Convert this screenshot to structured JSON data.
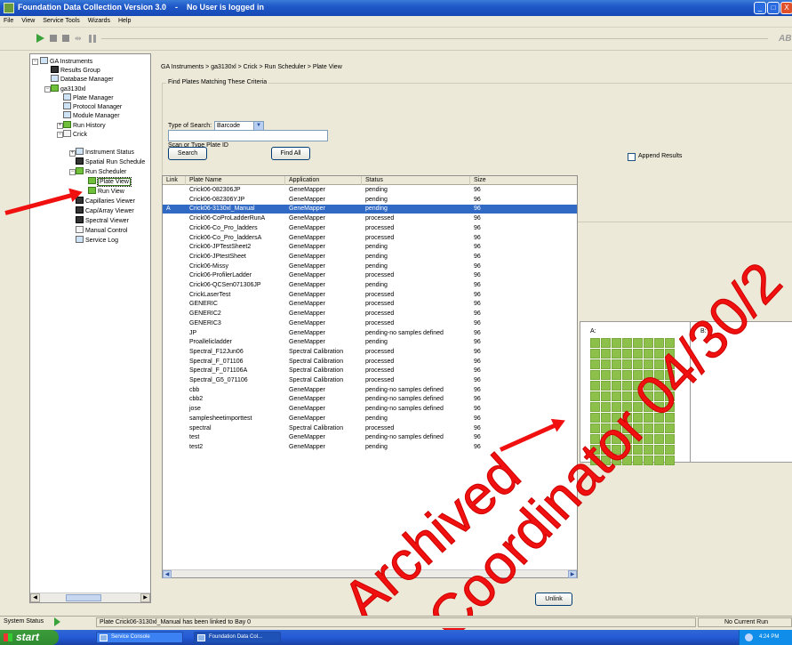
{
  "window": {
    "title": "Foundation Data Collection Version 3.0    -    No User is logged in",
    "controls": [
      "_",
      "□",
      "X"
    ]
  },
  "menu": [
    "File",
    "View",
    "Service Tools",
    "Wizards",
    "Help"
  ],
  "toolbar": {
    "brand": "AB"
  },
  "tree": {
    "nodes": [
      {
        "label": "GA Instruments",
        "icon": "instrument-icon"
      },
      {
        "label": "Results Group",
        "icon": "results-group-icon"
      },
      {
        "label": "Database Manager",
        "icon": "database-icon"
      },
      {
        "label": "ga3130xl",
        "icon": "instrument-icon"
      },
      {
        "label": "Plate Manager",
        "icon": "plate-manager-icon"
      },
      {
        "label": "Protocol Manager",
        "icon": "protocol-icon"
      },
      {
        "label": "Module Manager",
        "icon": "module-icon"
      },
      {
        "label": "Run History",
        "icon": "run-history-icon"
      },
      {
        "label": "Crick",
        "icon": "folder-icon"
      },
      {
        "label": "Instrument Status",
        "icon": "status-icon"
      },
      {
        "label": "Spatial Run Schedule",
        "icon": "spatial-icon"
      },
      {
        "label": "Run Scheduler",
        "icon": "scheduler-icon"
      },
      {
        "label": "Plate View",
        "icon": "plate-view-icon"
      },
      {
        "label": "Run View",
        "icon": "run-view-icon"
      },
      {
        "label": "Capillaries Viewer",
        "icon": "capillaries-icon"
      },
      {
        "label": "Cap/Array Viewer",
        "icon": "cap-array-icon"
      },
      {
        "label": "Spectral Viewer",
        "icon": "spectral-icon"
      },
      {
        "label": "Manual Control",
        "icon": "manual-control-icon"
      },
      {
        "label": "Service Log",
        "icon": "service-log-icon"
      }
    ]
  },
  "main": {
    "breadcrumb": "GA Instruments > ga3130xl > Crick > Run Scheduler > Plate View",
    "criteria_legend": "Find Plates Matching These Criteria",
    "type_of_search_label": "Type of Search:",
    "type_of_search_value": "Barcode",
    "scan_label": "Scan or Type Plate ID",
    "plate_id_value": "",
    "search_button": "Search",
    "find_all_button": "Find All",
    "append_results_label": "Append Results",
    "unlink_button": "Unlink"
  },
  "table": {
    "columns": [
      "Link",
      "Plate Name",
      "Application",
      "Status",
      "Size"
    ],
    "rows": [
      [
        "",
        "Crick06-082306JP",
        "GeneMapper",
        "pending",
        "96"
      ],
      [
        "",
        "Crick06-082306YJP",
        "GeneMapper",
        "pending",
        "96"
      ],
      [
        "A",
        "Crick06-3130xl_Manual",
        "GeneMapper",
        "pending",
        "96"
      ],
      [
        "",
        "Crick06-CoProLadderRunA",
        "GeneMapper",
        "processed",
        "96"
      ],
      [
        "",
        "Crick06-Co_Pro_ladders",
        "GeneMapper",
        "processed",
        "96"
      ],
      [
        "",
        "Crick06-Co_Pro_laddersA",
        "GeneMapper",
        "processed",
        "96"
      ],
      [
        "",
        "Crick06-JPTestSheet2",
        "GeneMapper",
        "pending",
        "96"
      ],
      [
        "",
        "Crick06-JPtestSheet",
        "GeneMapper",
        "pending",
        "96"
      ],
      [
        "",
        "Crick06-Missy",
        "GeneMapper",
        "pending",
        "96"
      ],
      [
        "",
        "Crick06-ProfilerLadder",
        "GeneMapper",
        "processed",
        "96"
      ],
      [
        "",
        "Crick06-QCSen071306JP",
        "GeneMapper",
        "pending",
        "96"
      ],
      [
        "",
        "CrickLaserTest",
        "GeneMapper",
        "processed",
        "96"
      ],
      [
        "",
        "GENERIC",
        "GeneMapper",
        "processed",
        "96"
      ],
      [
        "",
        "GENERIC2",
        "GeneMapper",
        "processed",
        "96"
      ],
      [
        "",
        "GENERIC3",
        "GeneMapper",
        "processed",
        "96"
      ],
      [
        "",
        "JP",
        "GeneMapper",
        "pending-no samples defined",
        "96"
      ],
      [
        "",
        "Proallelicladder",
        "GeneMapper",
        "pending",
        "96"
      ],
      [
        "",
        "Spectral_F12Jun06",
        "Spectral Calibration",
        "processed",
        "96"
      ],
      [
        "",
        "Spectral_F_071106",
        "Spectral Calibration",
        "processed",
        "96"
      ],
      [
        "",
        "Spectral_F_071106A",
        "Spectral Calibration",
        "processed",
        "96"
      ],
      [
        "",
        "Spectral_G5_071106",
        "Spectral Calibration",
        "processed",
        "96"
      ],
      [
        "",
        "cbb",
        "GeneMapper",
        "pending-no samples defined",
        "96"
      ],
      [
        "",
        "cbb2",
        "GeneMapper",
        "pending-no samples defined",
        "96"
      ],
      [
        "",
        "jose",
        "GeneMapper",
        "pending-no samples defined",
        "96"
      ],
      [
        "",
        "samplesheetimporttest",
        "GeneMapper",
        "pending",
        "96"
      ],
      [
        "",
        "spectral",
        "Spectral Calibration",
        "processed",
        "96"
      ],
      [
        "",
        "test",
        "GeneMapper",
        "pending-no samples defined",
        "96"
      ],
      [
        "",
        "test2",
        "GeneMapper",
        "pending",
        "96"
      ]
    ],
    "selected_row": 2
  },
  "plates": {
    "a_label": "A:",
    "b_label": "B:",
    "well_color": "#8cc04a"
  },
  "watermark": {
    "line1": "Archived",
    "line2": "Coordinator 04/30/2"
  },
  "status": {
    "label": "System Status",
    "message": "Plate Crick06-3130xl_Manual has been linked to Bay 0",
    "run": "No Current Run"
  },
  "taskbar": {
    "start": "start",
    "tasks": [
      "Service Console",
      "Foundation Data Col..."
    ],
    "clock": "4:24 PM"
  },
  "colors": {
    "selection": "#316ac5",
    "accent_red": "#f01010",
    "title_blue": "#1f58c8"
  }
}
